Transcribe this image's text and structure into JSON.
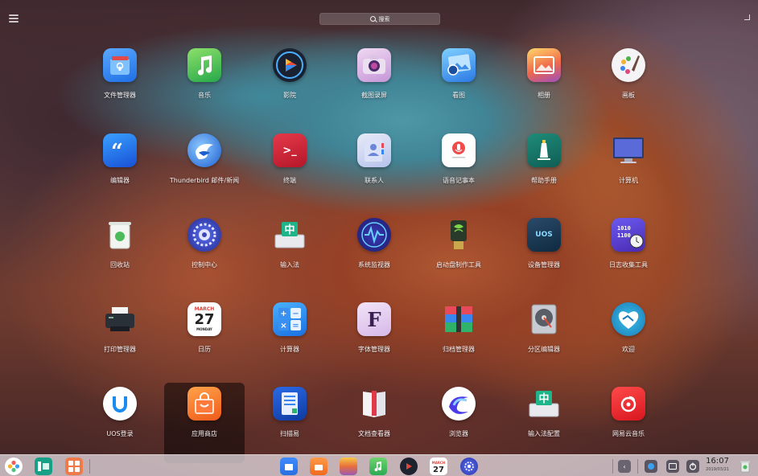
{
  "search": {
    "placeholder": "搜索"
  },
  "apps": [
    {
      "label": "文件管理器",
      "icon": "folder-icon",
      "col": 0,
      "row": 0
    },
    {
      "label": "音乐",
      "icon": "music-icon",
      "col": 1,
      "row": 0
    },
    {
      "label": "影院",
      "icon": "video-play-icon",
      "col": 2,
      "row": 0
    },
    {
      "label": "截图录屏",
      "icon": "camera-icon",
      "col": 3,
      "row": 0
    },
    {
      "label": "看图",
      "icon": "image-viewer-icon",
      "col": 4,
      "row": 0
    },
    {
      "label": "相册",
      "icon": "album-icon",
      "col": 5,
      "row": 0
    },
    {
      "label": "画板",
      "icon": "palette-icon",
      "col": 6,
      "row": 0
    },
    {
      "label": "编辑器",
      "icon": "quote-editor-icon",
      "col": 0,
      "row": 1
    },
    {
      "label": "Thunderbird 邮件/新闻",
      "icon": "thunderbird-icon",
      "col": 1,
      "row": 1
    },
    {
      "label": "终端",
      "icon": "terminal-icon",
      "col": 2,
      "row": 1
    },
    {
      "label": "联系人",
      "icon": "contacts-icon",
      "col": 3,
      "row": 1
    },
    {
      "label": "语音记事本",
      "icon": "microphone-icon",
      "col": 4,
      "row": 1
    },
    {
      "label": "帮助手册",
      "icon": "manual-icon",
      "col": 5,
      "row": 1
    },
    {
      "label": "计算机",
      "icon": "monitor-icon",
      "col": 6,
      "row": 1
    },
    {
      "label": "回收站",
      "icon": "trash-icon",
      "col": 0,
      "row": 2
    },
    {
      "label": "控制中心",
      "icon": "settings-gear-icon",
      "col": 1,
      "row": 2
    },
    {
      "label": "输入法",
      "icon": "keyboard-zh-icon",
      "col": 2,
      "row": 2
    },
    {
      "label": "系统监视器",
      "icon": "system-monitor-icon",
      "col": 3,
      "row": 2
    },
    {
      "label": "启动盘制作工具",
      "icon": "usb-drive-icon",
      "col": 4,
      "row": 2
    },
    {
      "label": "设备管理器",
      "icon": "chip-icon",
      "col": 5,
      "row": 2
    },
    {
      "label": "日志收集工具",
      "icon": "log-clock-icon",
      "col": 6,
      "row": 2
    },
    {
      "label": "打印管理器",
      "icon": "printer-icon",
      "col": 0,
      "row": 3
    },
    {
      "label": "日历",
      "icon": "calendar-icon",
      "col": 1,
      "row": 3
    },
    {
      "label": "计算器",
      "icon": "calculator-icon",
      "col": 2,
      "row": 3
    },
    {
      "label": "字体管理器",
      "icon": "font-icon",
      "col": 3,
      "row": 3
    },
    {
      "label": "归档管理器",
      "icon": "archive-icon",
      "col": 4,
      "row": 3
    },
    {
      "label": "分区编辑器",
      "icon": "disk-icon",
      "col": 5,
      "row": 3
    },
    {
      "label": "欢迎",
      "icon": "welcome-heart-icon",
      "col": 6,
      "row": 3
    },
    {
      "label": "UOS登录",
      "icon": "uos-login-icon",
      "col": 0,
      "row": 4
    },
    {
      "label": "应用商店",
      "icon": "app-store-bag-icon",
      "col": 1,
      "row": 4,
      "selected": true
    },
    {
      "label": "扫描易",
      "icon": "scanner-icon",
      "col": 2,
      "row": 4
    },
    {
      "label": "文档查看器",
      "icon": "document-viewer-icon",
      "col": 3,
      "row": 4
    },
    {
      "label": "浏览器",
      "icon": "browser-icon",
      "col": 4,
      "row": 4
    },
    {
      "label": "输入法配置",
      "icon": "keyboard-config-icon",
      "col": 5,
      "row": 4
    },
    {
      "label": "网易云音乐",
      "icon": "netease-music-icon",
      "col": 6,
      "row": 4
    }
  ],
  "dock": {
    "calendar_day": "27",
    "calendar_month": "MARCH",
    "clock_time": "16:07",
    "clock_date": "2019/03/21"
  },
  "icon_texts": {
    "terminal": ">_",
    "keyboard_zh": "中",
    "keyboard_config": "中",
    "font": "F",
    "calendar_month": "MARCH",
    "calendar_day": "27",
    "calendar_weekday": "MONDAY",
    "chip": "UOS"
  }
}
